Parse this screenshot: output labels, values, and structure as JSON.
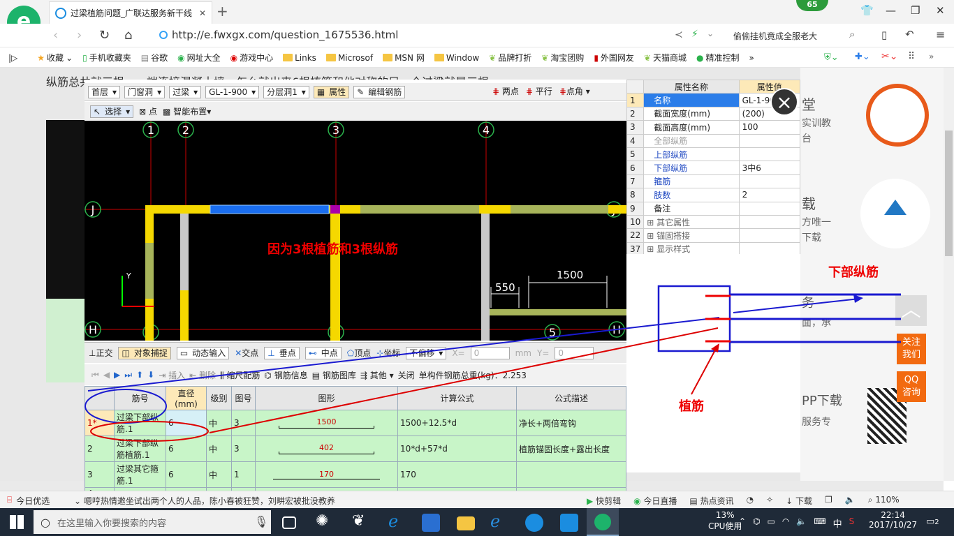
{
  "browser": {
    "tab_title": "过梁植筋问题_广联达服务新干线",
    "url": "http://e.fwxgx.com/question_1675536.html",
    "search_text": "偷偷挂机竟成全服老大",
    "badge": "65",
    "zoom": "110%"
  },
  "bookmarks": [
    {
      "label": "收藏",
      "icon": "star-icon"
    },
    {
      "label": "手机收藏夹",
      "icon": "phone-icon"
    },
    {
      "label": "谷歌",
      "icon": "page-icon"
    },
    {
      "label": "网址大全",
      "icon": "globe-icon"
    },
    {
      "label": "游戏中心",
      "icon": "game-icon"
    },
    {
      "label": "Links",
      "icon": "folder-icon"
    },
    {
      "label": "Microsof",
      "icon": "folder-icon"
    },
    {
      "label": "MSN 网",
      "icon": "folder-icon"
    },
    {
      "label": "Window",
      "icon": "folder-icon"
    },
    {
      "label": "品牌打折",
      "icon": "leaf-icon"
    },
    {
      "label": "淘宝团购",
      "icon": "leaf-icon"
    },
    {
      "label": "外国网友",
      "icon": "flag-icon"
    },
    {
      "label": "天猫商城",
      "icon": "leaf-icon"
    },
    {
      "label": "精准控制",
      "icon": "chat-icon"
    }
  ],
  "question_text": "纵筋总共就三根，一端连接混凝土墙，怎么就出来6根植筋和他对称的另一个过梁就是三根",
  "cad": {
    "toolbar1": {
      "floor": "首层",
      "type": "门窗洞",
      "component": "过梁",
      "name": "GL-1-900",
      "layer": "分层洞1",
      "attr_btn": "属性",
      "edit_rebar_btn": "编辑钢筋",
      "two_point": "两点",
      "parallel": "平行",
      "point_angle": "点角"
    },
    "toolbar2": {
      "select": "选择",
      "point": "点",
      "smart": "智能布置"
    },
    "axis_labels": [
      "1",
      "2",
      "3",
      "4",
      "J",
      "H",
      "1",
      "3",
      "5",
      "H",
      "J"
    ],
    "dims": [
      "550",
      "1500"
    ],
    "annotation": "因为3根植筋和3根纵筋",
    "snap": {
      "ortho": "正交",
      "snap": "对象捕捉",
      "dynamic": "动态输入",
      "intersect": "交点",
      "perp": "垂点",
      "mid": "中点",
      "vertex": "顶点",
      "coord": "坐标",
      "offset": "不偏移",
      "x_label": "X=",
      "x_val": "0",
      "mm": "mm",
      "y_label": "Y=",
      "y_val": "0"
    },
    "gridtools": {
      "insert": "插入",
      "delete": "删除",
      "scale": "缩尺配筋",
      "info": "钢筋信息",
      "library": "钢筋图库",
      "other": "其他",
      "close": "关闭",
      "total": "单构件钢筋总重(kg)：2.253"
    },
    "grid_headers": [
      "",
      "筋号",
      "直径(mm)",
      "级别",
      "图号",
      "图形",
      "计算公式",
      "公式描述"
    ],
    "grid_rows": [
      {
        "num": "1*",
        "name": "过梁下部纵筋.1",
        "dia": "6",
        "grade": "中",
        "fig": "3",
        "shape": "1500",
        "formula": "1500+12.5*d",
        "desc": "净长+两倍弯钩"
      },
      {
        "num": "2",
        "name": "过梁下部纵筋植筋.1",
        "dia": "6",
        "grade": "中",
        "fig": "3",
        "shape": "402",
        "formula": "10*d+57*d",
        "desc": "植筋锚固长度+露出长度"
      },
      {
        "num": "3",
        "name": "过梁其它箍筋.1",
        "dia": "6",
        "grade": "中",
        "fig": "1",
        "shape": "170",
        "formula": "170",
        "desc": ""
      },
      {
        "num": "4",
        "name": "",
        "dia": "",
        "grade": "",
        "fig": "",
        "shape": "",
        "formula": "",
        "desc": ""
      }
    ],
    "props_header": [
      "",
      "属性名称",
      "属性值"
    ],
    "props": [
      {
        "n": "1",
        "name": "名称",
        "value": "GL-1-900"
      },
      {
        "n": "2",
        "name": "截面宽度(mm)",
        "value": "(200)"
      },
      {
        "n": "3",
        "name": "截面高度(mm)",
        "value": "100"
      },
      {
        "n": "4",
        "name": "全部纵筋",
        "value": ""
      },
      {
        "n": "5",
        "name": "上部纵筋",
        "value": ""
      },
      {
        "n": "6",
        "name": "下部纵筋",
        "value": "3中6"
      },
      {
        "n": "7",
        "name": "箍筋",
        "value": ""
      },
      {
        "n": "8",
        "name": "肢数",
        "value": "2"
      },
      {
        "n": "9",
        "name": "备注",
        "value": ""
      },
      {
        "n": "10",
        "name": "其它属性",
        "value": ""
      },
      {
        "n": "22",
        "name": "锚固搭接",
        "value": ""
      },
      {
        "n": "37",
        "name": "显示样式",
        "value": ""
      }
    ]
  },
  "diagram_labels": {
    "bottom_rebar": "下部纵筋",
    "plant_rebar": "植筋"
  },
  "sidebar": {
    "t1": "堂",
    "t2": "实训教",
    "t3": "台",
    "t4": "载",
    "t5": "方唯一",
    "t6": "下载",
    "t7": "务",
    "t8": "面，承",
    "t9": "PP下载",
    "t10": "服务专",
    "follow1": "关注",
    "follow2": "我们",
    "qq1": "QQ",
    "qq2": "咨询"
  },
  "status": {
    "today": "今日优选",
    "news": "嗯哼热情邀坐试出两个人的人品，陈小春被狂赞，刘畊宏被批没教养",
    "kuaijian": "快剪辑",
    "live": "今日直播",
    "hot": "热点资讯",
    "download": "下载"
  },
  "taskbar": {
    "search": "在这里输入你要搜索的内容",
    "cpu": "13%",
    "cpu_label": "CPU使用",
    "ime": "中",
    "time": "22:14",
    "date": "2017/10/27",
    "notify": "2"
  }
}
